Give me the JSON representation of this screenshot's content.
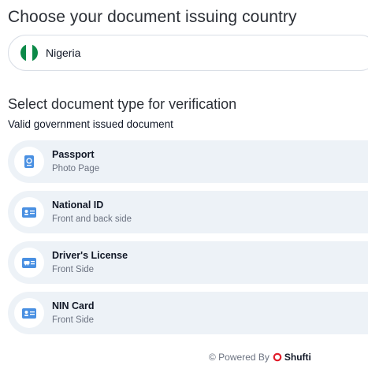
{
  "page": {
    "heading": "Choose your document issuing country",
    "doc_heading": "Select document type for verification",
    "doc_subheading": "Valid government issued document"
  },
  "country_select": {
    "value": "Nigeria",
    "flag_colors": [
      "#0c8a48",
      "#ffffff",
      "#0c8a48"
    ]
  },
  "documents": [
    {
      "title": "Passport",
      "subtitle": "Photo Page",
      "icon": "passport-icon"
    },
    {
      "title": "National ID",
      "subtitle": "Front and back side",
      "icon": "id-card-icon"
    },
    {
      "title": "Driver's License",
      "subtitle": "Front Side",
      "icon": "driver-license-icon"
    },
    {
      "title": "NIN Card",
      "subtitle": "Front Side",
      "icon": "id-card-icon"
    }
  ],
  "footer": {
    "powered_text": "© Powered By",
    "brand": "Shufti",
    "brand_color": "#e11d2a"
  },
  "colors": {
    "accent_icon": "#4a90e2",
    "card_bg": "#edf2f7"
  }
}
